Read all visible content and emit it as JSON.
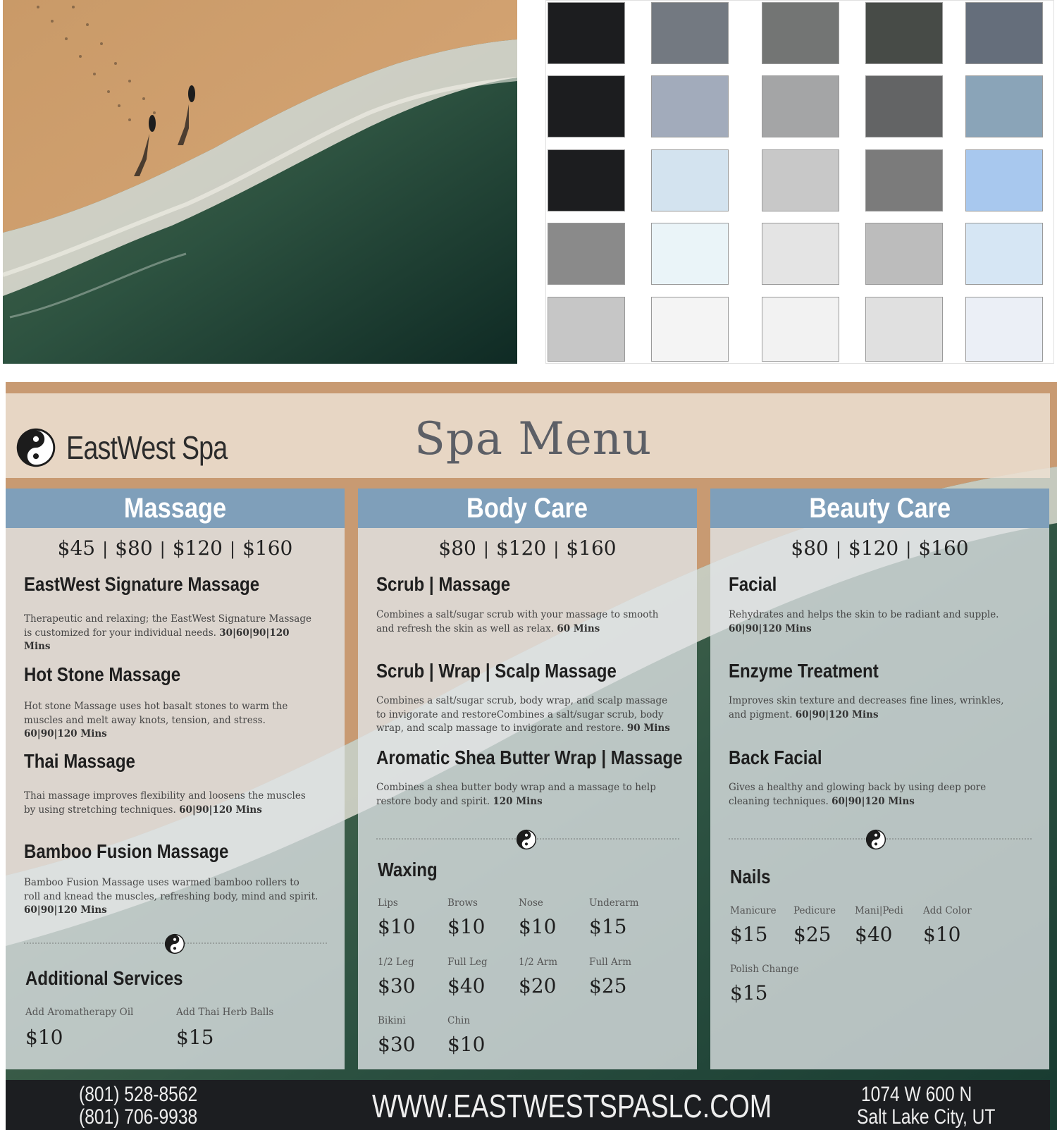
{
  "swatches": {
    "rows": [
      [
        "#1c1d1f",
        "#737981",
        "#737574",
        "#474b47",
        "#656e7b"
      ],
      [
        "#1c1d1f",
        "#a2abbb",
        "#a4a5a6",
        "#636465",
        "#8aa4b8"
      ],
      [
        "#1c1d1f",
        "#d3e3ef",
        "#c8c8c8",
        "#7b7b7b",
        "#a8c8ee"
      ],
      [
        "#8a8a8a",
        "#eaf4f8",
        "#e4e4e4",
        "#bcbcbc",
        "#d6e6f4"
      ],
      [
        "#c6c6c6",
        "#f4f4f4",
        "#f2f2f2",
        "#e0e0e0",
        "#ebeff6"
      ]
    ]
  },
  "colors": {
    "header_blue": "#7f9fba",
    "footer": "#1c1e21",
    "sand": "#c89a72",
    "sea": "#1f4a3c"
  },
  "header": {
    "brand": "EastWest Spa",
    "title": "Spa Menu",
    "logo_icon": "yin-yang-icon"
  },
  "massage": {
    "heading": "Massage",
    "prices": [
      "$45",
      "$80",
      "$120",
      "$160"
    ],
    "services": [
      {
        "title": "EastWest Signature Massage",
        "desc": "Therapeutic and relaxing; the EastWest Signature Massage is customized for your individual needs.",
        "duration": "30|60|90|120 Mins"
      },
      {
        "title": "Hot Stone Massage",
        "desc": "Hot stone Massage uses hot basalt stones to warm the muscles and melt away knots, tension, and stress.",
        "duration": "60|90|120 Mins"
      },
      {
        "title": "Thai Massage",
        "desc": "Thai massage improves flexibility and loosens the muscles by using stretching techniques.",
        "duration": "60|90|120 Mins"
      },
      {
        "title": "Bamboo Fusion Massage",
        "desc": "Bamboo Fusion Massage uses warmed bamboo rollers to roll and knead the muscles, refreshing body, mind and  spirit.",
        "duration": "60|90|120 Mins"
      }
    ],
    "additional": {
      "heading": "Additional Services",
      "items": [
        {
          "label": "Add Aromatherapy Oil",
          "price": "$10"
        },
        {
          "label": "Add Thai Herb Balls",
          "price": "$15"
        }
      ]
    }
  },
  "body_care": {
    "heading": "Body Care",
    "prices": [
      "$80",
      "$120",
      "$160"
    ],
    "services": [
      {
        "title": "Scrub | Massage",
        "desc": "Combines a salt/sugar scrub with your massage to smooth and refresh the skin as well as relax.",
        "duration": "60 Mins"
      },
      {
        "title": "Scrub | Wrap | Scalp Massage",
        "desc": "Combines a salt/sugar scrub, body wrap, and scalp massage to invigorate and restoreCombines a salt/sugar scrub, body wrap, and scalp massage to invigorate and restore.",
        "duration": "90 Mins"
      },
      {
        "title": "Aromatic Shea Butter Wrap | Massage",
        "desc": "Combines a shea butter body wrap and a massage to help restore body and spirit.",
        "duration": "120 Mins"
      }
    ],
    "waxing": {
      "heading": "Waxing",
      "items": [
        {
          "label": "Lips",
          "price": "$10"
        },
        {
          "label": "Brows",
          "price": "$10"
        },
        {
          "label": "Nose",
          "price": "$10"
        },
        {
          "label": "Underarm",
          "price": "$15"
        },
        {
          "label": "1/2 Leg",
          "price": "$30"
        },
        {
          "label": "Full Leg",
          "price": "$40"
        },
        {
          "label": "1/2 Arm",
          "price": "$20"
        },
        {
          "label": "Full Arm",
          "price": "$25"
        },
        {
          "label": "Bikini",
          "price": "$30"
        },
        {
          "label": "Chin",
          "price": "$10"
        }
      ]
    }
  },
  "beauty_care": {
    "heading": "Beauty Care",
    "prices": [
      "$80",
      "$120",
      "$160"
    ],
    "services": [
      {
        "title": "Facial",
        "desc": "Rehydrates and helps the skin to be radiant and supple.",
        "duration": "60|90|120 Mins"
      },
      {
        "title": "Enzyme Treatment",
        "desc": "Improves skin texture and decreases fine lines, wrinkles, and pigment.",
        "duration": "60|90|120 Mins"
      },
      {
        "title": "Back Facial",
        "desc": "Gives a healthy and glowing back by using deep pore cleaning techniques.",
        "duration": "60|90|120 Mins"
      }
    ],
    "nails": {
      "heading": "Nails",
      "items": [
        {
          "label": "Manicure",
          "price": "$15"
        },
        {
          "label": "Pedicure",
          "price": "$25"
        },
        {
          "label": "Mani|Pedi",
          "price": "$40"
        },
        {
          "label": "Add Color",
          "price": "$10"
        },
        {
          "label": "Polish Change",
          "price": "$15"
        }
      ]
    }
  },
  "footer": {
    "phone1": "(801) 528-8562",
    "phone2": "(801) 706-9938",
    "website": "WWW.EASTWESTSPASLC.COM",
    "address1": "1074 W 600 N",
    "address2": "Salt Lake City, UT"
  }
}
